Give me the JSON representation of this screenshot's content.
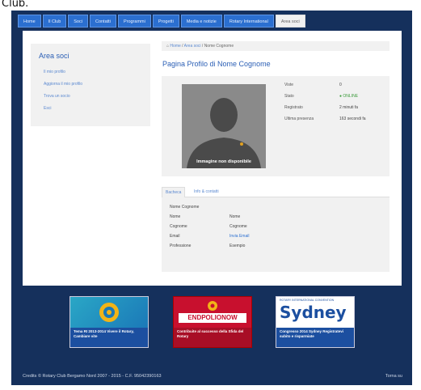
{
  "header_fragment": "Club.",
  "nav": [
    "Home",
    "Il Club",
    "Soci",
    "Contatti",
    "Programmi",
    "Progetti",
    "Media e notizie",
    "Rotary International",
    "Area soci"
  ],
  "nav_active": "Area soci",
  "sidebar": {
    "title": "Area soci",
    "items": [
      "Il mio profilo",
      "Aggiorna il mio profilo",
      "Trova un socio",
      "Esci"
    ]
  },
  "breadcrumb": {
    "home": "Home",
    "area": "Area soci",
    "current": "Nome Cognome"
  },
  "page_title": "Pagina Profilo di Nome Cognome",
  "avatar_caption": "Immagine non disponibile",
  "stats": [
    {
      "label": "Viste",
      "value": "0"
    },
    {
      "label": "Stato",
      "value": "● ONLINE"
    },
    {
      "label": "Registrato",
      "value": "2 minuti fa"
    },
    {
      "label": "Ultima presenza",
      "value": "163 secondi fa"
    }
  ],
  "tabs": [
    "Bacheca",
    "Info & contatti"
  ],
  "details": {
    "name": "Nome Cognome",
    "rows": [
      {
        "label": "Nome",
        "value": "Nome"
      },
      {
        "label": "Cognome",
        "value": "Cognome"
      },
      {
        "label": "Email",
        "value": "Invia Email"
      },
      {
        "label": "Professione",
        "value": "Esempio"
      }
    ]
  },
  "banners": [
    {
      "caption": "Tema RI 2013-2014 Vivere il Rotary, Cambiare vite"
    },
    {
      "logo": "ENDPOLIONOW",
      "caption": "Contribuite al successo della Sfida del Rotary"
    },
    {
      "top": "ROTARY INTERNATIONAL CONVENTION",
      "logo": "Sydney",
      "caption": "Congresso 2014 Sydney Registratevi subito e risparmiate"
    }
  ],
  "footer": {
    "credits": "Credits © Rotary Club Bergamo Nord 2007 - 2015 - C.F. 95042390163",
    "right": "Torna su"
  },
  "colors": {
    "frame": "#15305c",
    "nav": "#2b6fd0",
    "title": "#2b5fb5",
    "online": "#3a9a3a"
  }
}
